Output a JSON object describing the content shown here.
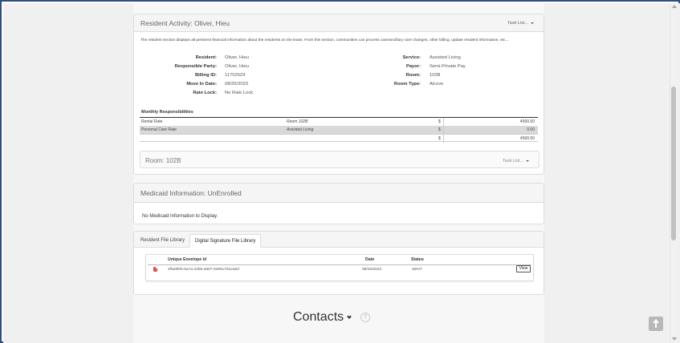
{
  "resident_activity": {
    "title": "Resident Activity: Oliver, Hieu",
    "task_list_label": "Task List...",
    "description": "The resident section displays all pertinent financial information about the residents on the lease. From this section, communities can process care/ancillary care changes, other billing, update resident information, etc...",
    "fields_left": [
      {
        "label": "Resident:",
        "value": "Oliver, Hieu"
      },
      {
        "label": "Responsible Party:",
        "value": "Oliver, Hieu"
      },
      {
        "label": "Billing ID:",
        "value": "11702524"
      },
      {
        "label": "Move In Date:",
        "value": "08/25/2023"
      },
      {
        "label": "Rate Lock:",
        "value": "No Rate Lock"
      }
    ],
    "fields_right": [
      {
        "label": "Service:",
        "value": "Assisted Living"
      },
      {
        "label": "Payor:",
        "value": "Semi-Private Pay"
      },
      {
        "label": "Room:",
        "value": "102B"
      },
      {
        "label": "Room Type:",
        "value": "Alcove"
      }
    ],
    "monthly": {
      "title": "Monthly Responsibilities",
      "rows": [
        {
          "name": "Rental Rate",
          "detail": "Room 102B",
          "currency": "$",
          "amount": "4500.00"
        },
        {
          "name": "Personal Care Rate",
          "detail": "Assisted Living",
          "currency": "$",
          "amount": "0.00"
        },
        {
          "name": "",
          "detail": "",
          "currency": "$",
          "amount": "4500.00"
        }
      ]
    },
    "room_panel": {
      "title": "Room: 102B",
      "task_list_label": "Task List..."
    }
  },
  "medicaid": {
    "title": "Medicaid Information: UnEnrolled",
    "message": "No Medicaid Information to Display."
  },
  "files": {
    "tabs": [
      {
        "label": "Resident File Library",
        "active": false
      },
      {
        "label": "Digital Signature File Library",
        "active": true
      }
    ],
    "columns": {
      "envelope": "Unique Envelope Id",
      "date": "Date",
      "status": "Status"
    },
    "rows": [
      {
        "icon": "pdf-icon",
        "envelope": "2f5a9feb-5a7a-42b5-a607-6295c761ea0d",
        "date": "08/25/2023",
        "status": "SENT",
        "action": "View"
      }
    ]
  },
  "contacts": {
    "label": "Contacts",
    "help": "?"
  },
  "colors": {
    "frame": "#2f4f7f",
    "pdf": "#d9534f",
    "row_shade": "#d9d9d9"
  }
}
